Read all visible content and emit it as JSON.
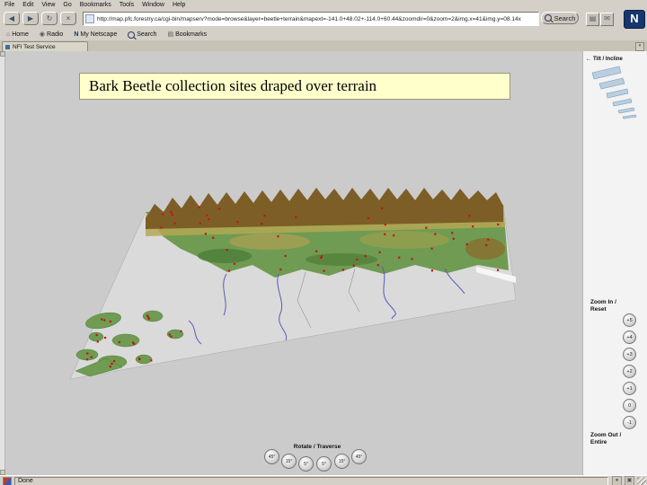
{
  "browser": {
    "menu": [
      "File",
      "Edit",
      "View",
      "Go",
      "Bookmarks",
      "Tools",
      "Window",
      "Help"
    ],
    "nav_icons": {
      "back": "◀",
      "forward": "▶",
      "reload": "↻",
      "stop": "×"
    },
    "url": "http://map.pfc.forestry.ca/cgi-bin/mapserv?mode=browse&layer=beetle+terrain&mapext=-141.0+48.02+-114.0+60.44&zoomdir=0&zoom=2&img.x=41&img.y=08.14x",
    "search_label": "Search",
    "personal_toolbar": [
      "Home",
      "Radio",
      "My Netscape",
      "Search",
      "Bookmarks"
    ],
    "tab_label": "NFI Test Service",
    "status": "Done"
  },
  "page": {
    "banner": "Bark Beetle collection sites draped over terrain",
    "tilt": {
      "arrow": "←",
      "label": "Tilt / Incline"
    },
    "zoom_in": {
      "line1": "Zoom In /",
      "line2": "Reset"
    },
    "zoom_out": {
      "line1": "Zoom Out /",
      "line2": "Entire"
    },
    "zoom_buttons": [
      "+5",
      "+4",
      "+3",
      "+2",
      "+1",
      "0",
      "-1"
    ],
    "rotate": {
      "label": "Rotate / Traverse",
      "buttons": [
        "45°",
        "15°",
        "5°",
        "5°",
        "15°",
        "45°"
      ]
    }
  },
  "colors": {
    "banner_bg": "#ffffcc",
    "logo_bg": "#16366e",
    "terrain_green": "#6f9b52",
    "mountain_brown": "#7d5e26",
    "site_dot": "#c41414",
    "water_line": "#5a5ab8"
  }
}
